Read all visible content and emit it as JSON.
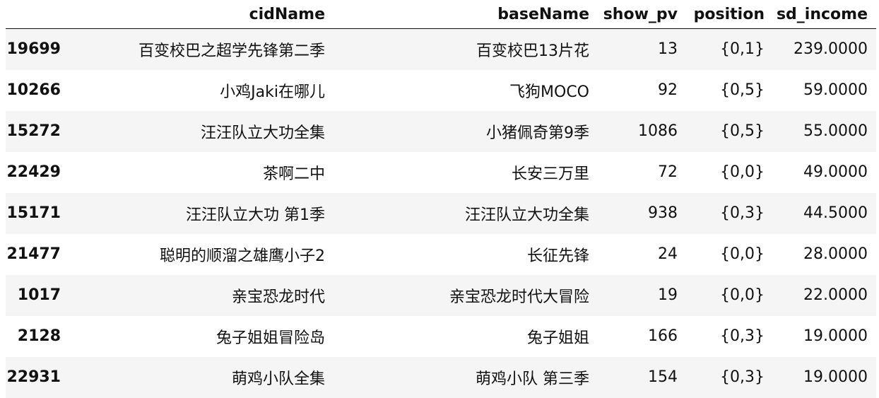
{
  "table": {
    "columns": [
      "",
      "cidName",
      "baseName",
      "show_pv",
      "position",
      "sd_income"
    ],
    "rows": [
      {
        "index": "19699",
        "cidName": "百变校巴之超学先锋第二季",
        "baseName": "百变校巴13片花",
        "show_pv": "13",
        "position": "{0,1}",
        "sd_income": "239.0000"
      },
      {
        "index": "10266",
        "cidName": "小鸡Jaki在哪儿",
        "baseName": "飞狗MOCO",
        "show_pv": "92",
        "position": "{0,5}",
        "sd_income": "59.0000"
      },
      {
        "index": "15272",
        "cidName": "汪汪队立大功全集",
        "baseName": "小猪佩奇第9季",
        "show_pv": "1086",
        "position": "{0,5}",
        "sd_income": "55.0000"
      },
      {
        "index": "22429",
        "cidName": "茶啊二中",
        "baseName": "长安三万里",
        "show_pv": "72",
        "position": "{0,0}",
        "sd_income": "49.0000"
      },
      {
        "index": "15171",
        "cidName": "汪汪队立大功 第1季",
        "baseName": "汪汪队立大功全集",
        "show_pv": "938",
        "position": "{0,3}",
        "sd_income": "44.5000"
      },
      {
        "index": "21477",
        "cidName": "聪明的顺溜之雄鹰小子2",
        "baseName": "长征先锋",
        "show_pv": "24",
        "position": "{0,0}",
        "sd_income": "28.0000"
      },
      {
        "index": "1017",
        "cidName": "亲宝恐龙时代",
        "baseName": "亲宝恐龙时代大冒险",
        "show_pv": "19",
        "position": "{0,0}",
        "sd_income": "22.0000"
      },
      {
        "index": "2128",
        "cidName": "兔子姐姐冒险岛",
        "baseName": "兔子姐姐",
        "show_pv": "166",
        "position": "{0,3}",
        "sd_income": "19.0000"
      },
      {
        "index": "22931",
        "cidName": "萌鸡小队全集",
        "baseName": "萌鸡小队 第三季",
        "show_pv": "154",
        "position": "{0,3}",
        "sd_income": "19.0000"
      }
    ]
  }
}
